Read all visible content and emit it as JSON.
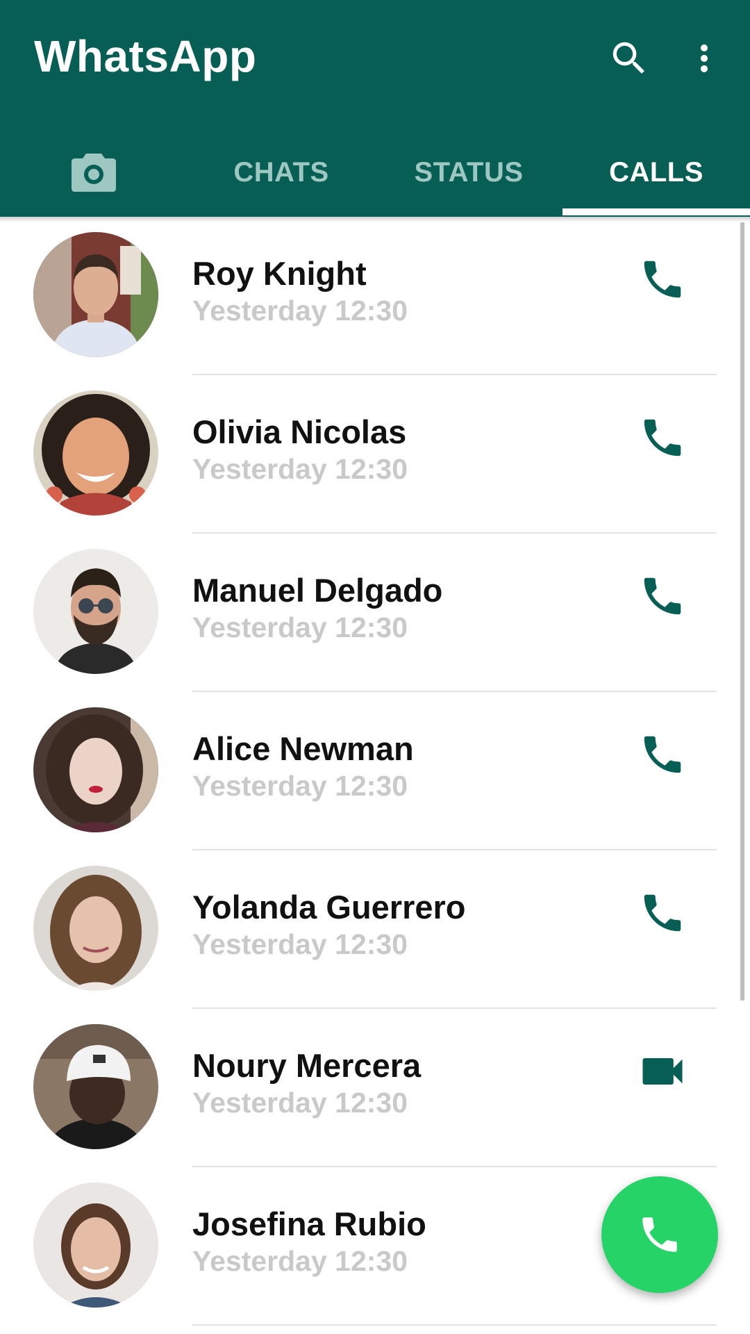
{
  "app": {
    "title": "WhatsApp"
  },
  "header": {
    "icons": {
      "search": "search-icon",
      "more": "more-vert-icon"
    }
  },
  "tabs": [
    {
      "id": "camera",
      "icon": "camera-icon"
    },
    {
      "id": "chats",
      "label": "CHATS"
    },
    {
      "id": "status",
      "label": "STATUS"
    },
    {
      "id": "calls",
      "label": "CALLS",
      "active": true
    }
  ],
  "calls": [
    {
      "name": "Roy Knight",
      "time": "Yesterday 12:30",
      "type": "voice"
    },
    {
      "name": "Olivia Nicolas",
      "time": "Yesterday 12:30",
      "type": "voice"
    },
    {
      "name": "Manuel Delgado",
      "time": "Yesterday 12:30",
      "type": "voice"
    },
    {
      "name": "Alice Newman",
      "time": "Yesterday 12:30",
      "type": "voice"
    },
    {
      "name": "Yolanda Guerrero",
      "time": "Yesterday 12:30",
      "type": "voice"
    },
    {
      "name": "Noury Mercera",
      "time": "Yesterday 12:30",
      "type": "video"
    },
    {
      "name": "Josefina Rubio",
      "time": "Yesterday 12:30",
      "type": "voice"
    }
  ],
  "fab": {
    "icon": "phone-icon"
  },
  "colors": {
    "primary": "#075e54",
    "accent": "#25d366",
    "tab_inactive": "#9dc7c0",
    "icon_teal": "#075e54",
    "secondary_text": "#c9c9c9"
  }
}
